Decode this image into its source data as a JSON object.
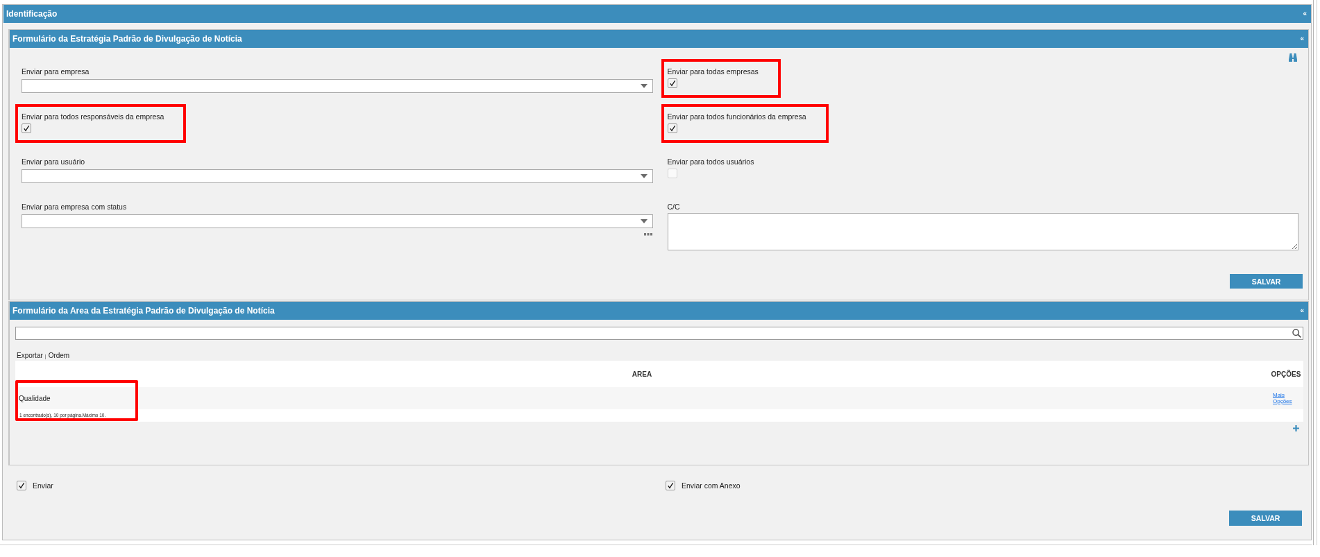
{
  "section": {
    "title": "Identificação",
    "collapse": "«"
  },
  "form_panel": {
    "title": "Formulário da Estratégia Padrão de Divulgação de Notícia",
    "collapse": "«",
    "fields": [
      {
        "kind": "select",
        "label": "Enviar para empresa",
        "more": false,
        "highlighted": false
      },
      {
        "kind": "checkbox",
        "label": "Enviar para todas empresas",
        "checked": true,
        "disabled": false,
        "highlighted": true
      },
      {
        "kind": "checkbox",
        "label": "Enviar para todos responsáveis da empresa",
        "checked": true,
        "disabled": false,
        "highlighted": true
      },
      {
        "kind": "checkbox",
        "label": "Enviar para todos funcionários da empresa",
        "checked": true,
        "disabled": false,
        "highlighted": true
      },
      {
        "kind": "select",
        "label": "Enviar para usuário",
        "more": false,
        "highlighted": false
      },
      {
        "kind": "checkbox",
        "label": "Enviar para todos usuários",
        "checked": false,
        "disabled": true,
        "highlighted": false
      },
      {
        "kind": "select",
        "label": "Enviar para empresa com status",
        "more": true,
        "highlighted": false
      },
      {
        "kind": "textarea",
        "label": "C/C",
        "highlighted": false
      }
    ],
    "save_button": "SALVAR"
  },
  "area_panel": {
    "title": "Formulário da Area da Estratégia Padrão de Divulgação de Notícia",
    "collapse": "«",
    "toolbar": {
      "links": [
        "Exportar",
        "Ordem"
      ],
      "separator": "|"
    },
    "table": {
      "columns": [
        "AREA",
        "OPÇÕES"
      ],
      "rows": [
        {
          "area": "Qualidade",
          "action": "Mais Opções"
        }
      ],
      "footer": "1 encontrado(s), 10 por página.Máximo 10.",
      "highlighted": true
    }
  },
  "send_options": [
    {
      "label": "Enviar",
      "checked": true
    },
    {
      "label": "Enviar com Anexo",
      "checked": true
    }
  ],
  "save_button": "SALVAR"
}
